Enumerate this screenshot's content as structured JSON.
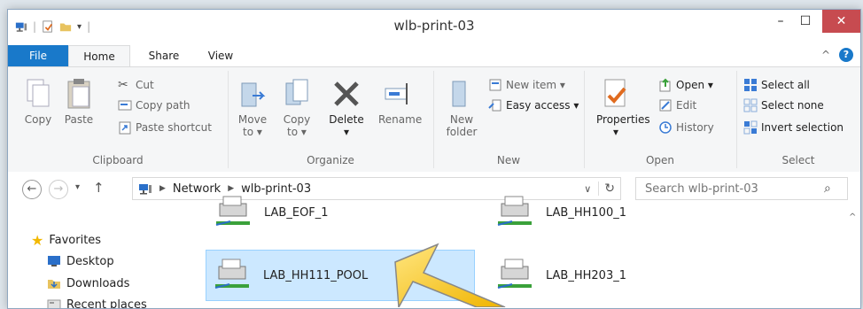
{
  "window": {
    "title": "wlb-print-03"
  },
  "controls": {
    "minimize": "–",
    "maximize": "☐",
    "close": "✕"
  },
  "tabs": [
    "File",
    "Home",
    "Share",
    "View"
  ],
  "ribbon": {
    "clipboard": {
      "label": "Clipboard",
      "copy": "Copy",
      "paste": "Paste",
      "cut": "Cut",
      "copy_path": "Copy path",
      "paste_shortcut": "Paste shortcut"
    },
    "organize": {
      "label": "Organize",
      "move_to": "Move",
      "move_to2": "to ▾",
      "copy_to": "Copy",
      "copy_to2": "to ▾",
      "delete": "Delete",
      "delete2": "▾",
      "rename": "Rename"
    },
    "new": {
      "label": "New",
      "new_folder": "New",
      "new_folder2": "folder",
      "new_item": "New item ▾",
      "easy_access": "Easy access ▾"
    },
    "open": {
      "label": "Open",
      "properties": "Properties",
      "properties2": "▾",
      "open": "Open ▾",
      "edit": "Edit",
      "history": "History"
    },
    "select": {
      "label": "Select",
      "select_all": "Select all",
      "select_none": "Select none",
      "invert": "Invert selection"
    }
  },
  "address": {
    "crumbs": [
      "Network",
      "wlb-print-03"
    ],
    "search_placeholder": "Search wlb-print-03"
  },
  "nav": {
    "favorites": "Favorites",
    "items": [
      "Desktop",
      "Downloads",
      "Recent places"
    ]
  },
  "printers": [
    {
      "name": "LAB_EOF_1"
    },
    {
      "name": "LAB_HH100_1"
    },
    {
      "name": "LAB_HH111_POOL"
    },
    {
      "name": "LAB_HH203_1"
    }
  ],
  "colors": {
    "accent": "#1979ca",
    "selection": "#cce8ff",
    "close": "#c74b50",
    "arrow": "#f0b400"
  }
}
